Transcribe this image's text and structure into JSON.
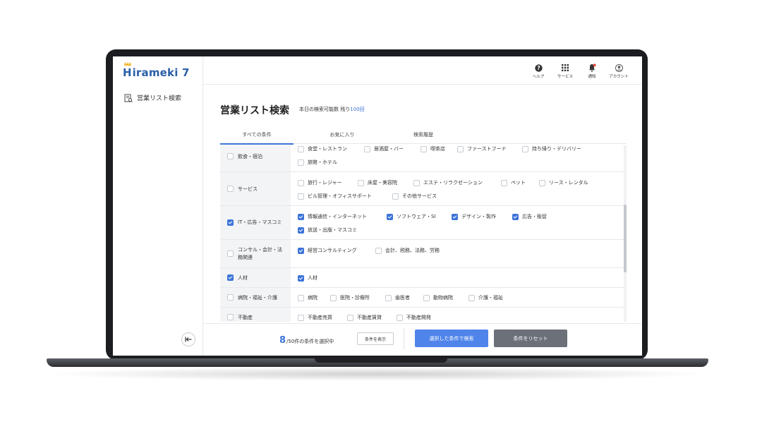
{
  "app": {
    "logo_text": "irameki 7",
    "logo_initial": "H"
  },
  "sidebar": {
    "items": [
      {
        "label": "営業リスト検索"
      }
    ]
  },
  "topbar": {
    "icons": [
      {
        "label": "ヘルプ",
        "icon": "help-icon"
      },
      {
        "label": "サービス",
        "icon": "grid-icon"
      },
      {
        "label": "通知",
        "icon": "bell-icon"
      },
      {
        "label": "アカウント",
        "icon": "account-icon"
      }
    ]
  },
  "page": {
    "title": "営業リスト検索",
    "quota_prefix": "本日の検索可能数 残り",
    "quota_count": "100回"
  },
  "tabs": [
    {
      "label": "すべての条件"
    },
    {
      "label": "お気に入り"
    },
    {
      "label": "検索履歴"
    }
  ],
  "categories": [
    {
      "name": "飲食・宿泊",
      "checked": false,
      "options": [
        {
          "label": "食堂・レストラン",
          "checked": false
        },
        {
          "label": "居酒屋・バー",
          "checked": false
        },
        {
          "label": "喫茶店",
          "checked": false
        },
        {
          "label": "ファーストフード",
          "checked": false
        },
        {
          "label": "持ち帰り・デリバリー",
          "checked": false
        },
        {
          "label": "旅館・ホテル",
          "checked": false
        }
      ]
    },
    {
      "name": "サービス",
      "checked": false,
      "options": [
        {
          "label": "旅行・レジャー",
          "checked": false
        },
        {
          "label": "床屋・美容院",
          "checked": false
        },
        {
          "label": "エステ・リラクゼーション",
          "checked": false
        },
        {
          "label": "ペット",
          "checked": false
        },
        {
          "label": "リース・レンタル",
          "checked": false
        },
        {
          "label": "ビル管理・オフィスサポート",
          "checked": false
        },
        {
          "label": "その他サービス",
          "checked": false
        }
      ]
    },
    {
      "name": "IT・広告・マスコミ",
      "checked": true,
      "options": [
        {
          "label": "情報通信・インターネット",
          "checked": true
        },
        {
          "label": "ソフトウェア・SI",
          "checked": true
        },
        {
          "label": "デザイン・製作",
          "checked": true
        },
        {
          "label": "広告・販促",
          "checked": true
        },
        {
          "label": "放送・出版・マスコミ",
          "checked": true
        }
      ]
    },
    {
      "name": "コンサル・会計・法務関連",
      "checked": false,
      "options": [
        {
          "label": "経営コンサルティング",
          "checked": true
        },
        {
          "label": "会計、税務、法務、労務",
          "checked": false
        }
      ]
    },
    {
      "name": "人材",
      "checked": true,
      "options": [
        {
          "label": "人材",
          "checked": true
        }
      ]
    },
    {
      "name": "病院・福祉・介護",
      "checked": false,
      "options": [
        {
          "label": "病院",
          "checked": false
        },
        {
          "label": "医院・診療所",
          "checked": false
        },
        {
          "label": "歯医者",
          "checked": false
        },
        {
          "label": "動物病院",
          "checked": false
        },
        {
          "label": "介護・福祉",
          "checked": false
        }
      ]
    },
    {
      "name": "不動産",
      "checked": false,
      "options": [
        {
          "label": "不動産売買",
          "checked": false
        },
        {
          "label": "不動産賃貸",
          "checked": false
        },
        {
          "label": "不動産開発",
          "checked": false
        }
      ]
    }
  ],
  "footer": {
    "selected": "8",
    "selected_suffix": "/50件の条件を選択中",
    "show_label": "条件を表示",
    "search_label": "選択した条件で検索",
    "reset_label": "条件をリセット"
  },
  "colors": {
    "accent": "#3c74d8",
    "search_button": "#4f84ea",
    "reset_button": "#6b7079"
  }
}
